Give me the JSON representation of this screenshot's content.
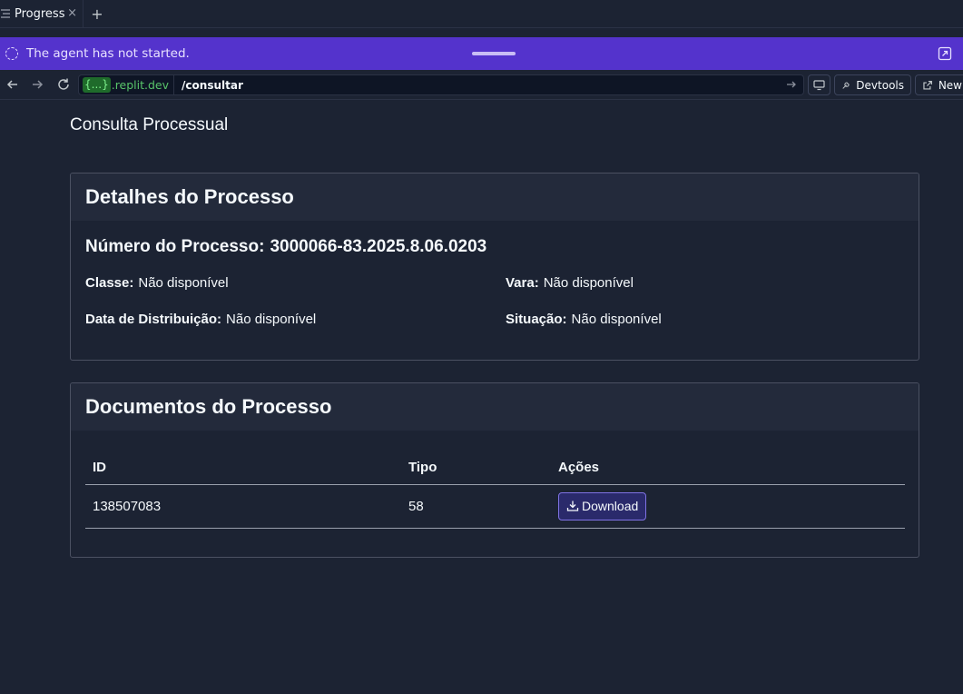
{
  "tabbar": {
    "tab_label": "Progress",
    "tab_icon": "list-icon",
    "add_label": "+"
  },
  "banner": {
    "status_text": "The agent has not started.",
    "accent": "#5433cc"
  },
  "navbar": {
    "url_badge": "{...}",
    "url_domain": ".replit.dev",
    "url_path": "/consultar",
    "devtools_label": "Devtools",
    "new_tab_label": "New"
  },
  "page": {
    "title": "Consulta Processual"
  },
  "details": {
    "heading": "Detalhes do Processo",
    "number_label": "Número do Processo:",
    "number_value": "3000066-83.2025.8.06.0203",
    "fields": [
      {
        "label": "Classe:",
        "value": "Não disponível"
      },
      {
        "label": "Vara:",
        "value": "Não disponível"
      },
      {
        "label": "Data de Distribuição:",
        "value": "Não disponível"
      },
      {
        "label": "Situação:",
        "value": "Não disponível"
      }
    ]
  },
  "documents": {
    "heading": "Documentos do Processo",
    "columns": [
      "ID",
      "Tipo",
      "Ações"
    ],
    "rows": [
      {
        "id": "138507083",
        "tipo": "58",
        "action_label": "Download"
      }
    ]
  }
}
